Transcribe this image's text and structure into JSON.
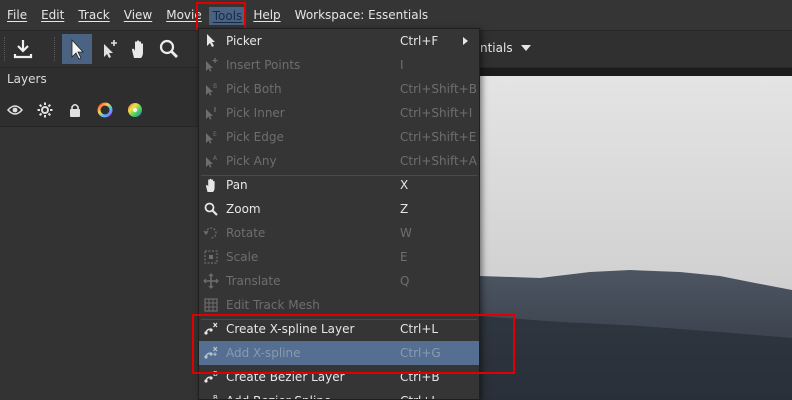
{
  "menubar": {
    "items": [
      {
        "label": "File"
      },
      {
        "label": "Edit"
      },
      {
        "label": "Track"
      },
      {
        "label": "View"
      },
      {
        "label": "Movie"
      },
      {
        "label": "Tools"
      },
      {
        "label": "Help"
      }
    ],
    "workspace_label": "Workspace: Essentials"
  },
  "toolbar": {
    "workspace_select_value": "ntials"
  },
  "layers": {
    "title": "Layers"
  },
  "tools_menu": {
    "items": [
      {
        "label": "Picker",
        "shortcut": "Ctrl+F",
        "enabled": true,
        "submenu": true,
        "icon": "pointer-icon"
      },
      {
        "label": "Insert Points",
        "shortcut": "I",
        "enabled": false,
        "icon": "insert-points-icon"
      },
      {
        "label": "Pick Both",
        "shortcut": "Ctrl+Shift+B",
        "enabled": false,
        "icon": "pick-both-icon"
      },
      {
        "label": "Pick Inner",
        "shortcut": "Ctrl+Shift+I",
        "enabled": false,
        "icon": "pick-inner-icon"
      },
      {
        "label": "Pick Edge",
        "shortcut": "Ctrl+Shift+E",
        "enabled": false,
        "icon": "pick-edge-icon"
      },
      {
        "label": "Pick Any",
        "shortcut": "Ctrl+Shift+A",
        "enabled": false,
        "icon": "pick-any-icon"
      },
      {
        "label": "Pan",
        "shortcut": "X",
        "enabled": true,
        "icon": "hand-icon"
      },
      {
        "label": "Zoom",
        "shortcut": "Z",
        "enabled": true,
        "icon": "magnifier-icon"
      },
      {
        "label": "Rotate",
        "shortcut": "W",
        "enabled": false,
        "icon": "rotate-icon"
      },
      {
        "label": "Scale",
        "shortcut": "E",
        "enabled": false,
        "icon": "scale-icon"
      },
      {
        "label": "Translate",
        "shortcut": "Q",
        "enabled": false,
        "icon": "translate-icon"
      },
      {
        "label": "Edit Track Mesh",
        "shortcut": "",
        "enabled": false,
        "icon": "mesh-icon"
      },
      {
        "label": "Create X-spline Layer",
        "shortcut": "Ctrl+L",
        "enabled": true,
        "icon": "xspline-create-icon"
      },
      {
        "label": "Add X-spline",
        "shortcut": "Ctrl+G",
        "enabled": false,
        "highlighted": true,
        "icon": "xspline-add-icon"
      },
      {
        "label": "Create Bezier Layer",
        "shortcut": "Ctrl+B",
        "enabled": true,
        "icon": "bezier-create-icon"
      },
      {
        "label": "Add Bezier Spline",
        "shortcut": "Ctrl+J",
        "enabled": true,
        "icon": "bezier-add-icon"
      }
    ]
  },
  "colors": {
    "menu_highlight": "#546f91",
    "annotation_red": "#e10000",
    "tools_selected": "#4a6383"
  }
}
